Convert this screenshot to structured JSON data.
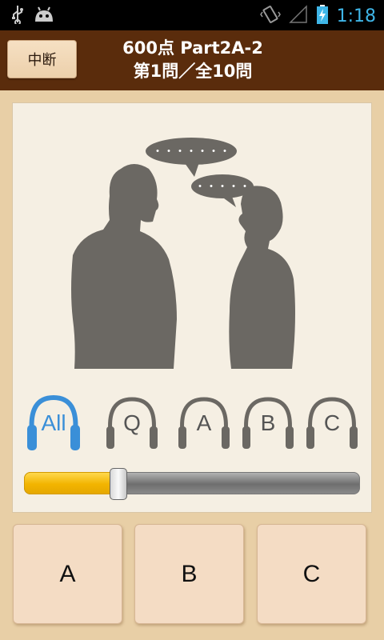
{
  "status_bar": {
    "time": "1:18",
    "icons": [
      "usb-icon",
      "android-icon",
      "vibrate-icon",
      "signal-icon",
      "battery-charging-icon"
    ]
  },
  "header": {
    "pause_label": "中断",
    "title_line1": "600点 Part2A-2",
    "title_line2": "第1問／全10問"
  },
  "illustration": {
    "bubble_left": "・・・・・・・",
    "bubble_right": "・・・・・"
  },
  "audio_tracks": [
    {
      "label": "All",
      "active": true
    },
    {
      "label": "Q",
      "active": false
    },
    {
      "label": "A",
      "active": false
    },
    {
      "label": "B",
      "active": false
    },
    {
      "label": "C",
      "active": false
    }
  ],
  "seek_bar": {
    "progress": 0.28
  },
  "answers": [
    {
      "label": "A"
    },
    {
      "label": "B"
    },
    {
      "label": "C"
    }
  ],
  "colors": {
    "header_bg": "#5a2c0c",
    "active_track": "#3a8fd8",
    "seek_fill": "#f2b400",
    "answer_bg": "#f4dcc4"
  }
}
